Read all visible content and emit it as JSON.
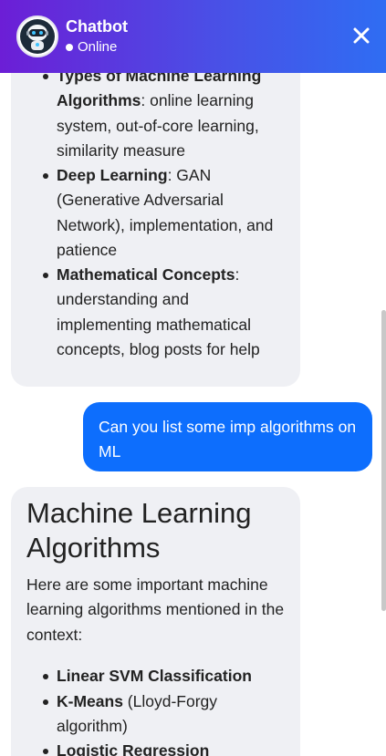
{
  "header": {
    "title": "Chatbot",
    "status": "Online",
    "avatar_icon": "robot-icon",
    "close_icon": "close-icon",
    "gradient_start": "#6c1ed6",
    "gradient_end": "#2f6df3"
  },
  "messages": [
    {
      "role": "bot",
      "bullets": [
        {
          "term": "Types of Machine Learning Algorithms",
          "text": ": online learning system, out-of-core learning, similarity measure"
        },
        {
          "term": "Deep Learning",
          "text": ": GAN (Generative Adversarial Network), implementation, and patience"
        },
        {
          "term": "Mathematical Concepts",
          "text": ": understanding and implementing mathematical concepts, blog posts for help"
        }
      ]
    },
    {
      "role": "user",
      "text": "Can you list some imp algorithms on ML"
    },
    {
      "role": "bot",
      "heading": "Machine Learning Algorithms",
      "intro": "Here are some important machine learning algorithms mentioned in the context:",
      "bullets": [
        {
          "term": "Linear SVM Classification",
          "text": ""
        },
        {
          "term": "K-Means",
          "text": " (Lloyd-Forgy algorithm)"
        },
        {
          "term": "Logistic Regression",
          "text": ""
        }
      ]
    }
  ],
  "colors": {
    "bot_bubble": "#eff0f4",
    "user_bubble": "#0d6efd"
  }
}
